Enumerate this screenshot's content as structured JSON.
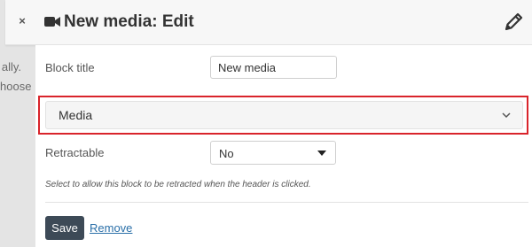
{
  "background": {
    "text_line_1": "ally.",
    "text_line_2": "hoose"
  },
  "modal": {
    "close_glyph": "×",
    "title_icon": "video-camera-icon",
    "title": "New media: Edit",
    "edit_icon": "pencil-icon"
  },
  "form": {
    "block_title_label": "Block title",
    "block_title_value": "New media",
    "media_section_label": "Media",
    "media_chevron_icon": "chevron-down-icon",
    "retractable_label": "Retractable",
    "retractable_value": "No",
    "retractable_help": "Select to allow this block to be retracted when the header is clicked.",
    "save_label": "Save",
    "remove_label": "Remove"
  },
  "colors": {
    "highlight_border": "#d9242b",
    "save_button_bg": "#3d4a57",
    "link": "#2a6fa8"
  }
}
